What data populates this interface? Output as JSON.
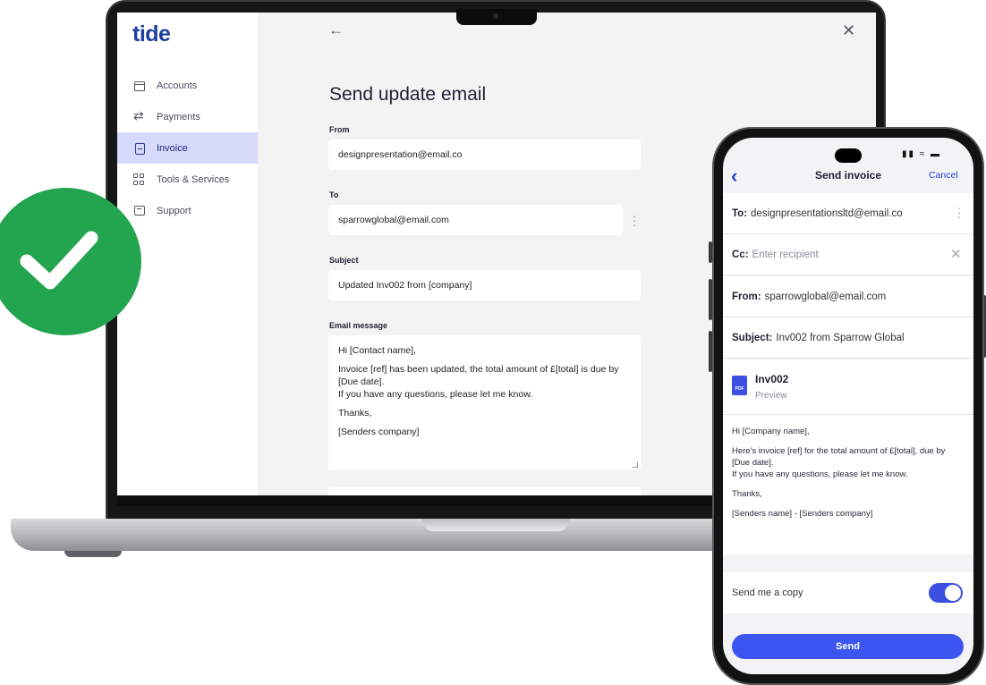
{
  "brand": {
    "logo": "tide"
  },
  "sidebar": {
    "items": [
      {
        "label": "Accounts",
        "icon": "accounts-icon"
      },
      {
        "label": "Payments",
        "icon": "transfer-icon"
      },
      {
        "label": "Invoice",
        "icon": "invoice-icon",
        "active": true
      },
      {
        "label": "Tools & Services",
        "icon": "grid-icon"
      },
      {
        "label": "Support",
        "icon": "chat-icon"
      }
    ]
  },
  "form": {
    "title": "Send update email",
    "from_label": "From",
    "from_value": "designpresentation@email.co",
    "to_label": "To",
    "to_value": "sparrowglobal@email.com",
    "subject_label": "Subject",
    "subject_value": "Updated Inv002 from [company]",
    "message_label": "Email message",
    "message": {
      "greeting": "Hi [Contact name],",
      "line1": "Invoice [ref] has  been updated, the total amount of £[total] is due by [Due date].",
      "line2": "If you have any questions, please let me know.",
      "signoff": "Thanks,",
      "signature": "[Senders company]"
    }
  },
  "phone": {
    "title": "Send invoice",
    "cancel": "Cancel",
    "to_label": "To:",
    "to_value": "designpresentationsltd@email.co",
    "cc_label": "Cc:",
    "cc_placeholder": "Enter recipient",
    "from_label": "From:",
    "from_value": "sparrowglobal@email.com",
    "subject_label": "Subject:",
    "subject_value": "Inv002 from Sparrow Global",
    "attachment": {
      "type": "PDF",
      "name": "Inv002",
      "sub": "Preview"
    },
    "body": {
      "greeting": "Hi [Company name],",
      "line1": "Here's invoice [ref] for the total amount of £[total], due by [Due date].",
      "line2": "If you have any questions, please let me know.",
      "signoff": "Thanks,",
      "signature": "[Senders name] - [Senders company]"
    },
    "copy_label": "Send me a copy",
    "copy_enabled": true,
    "send": "Send"
  },
  "colors": {
    "brand": "#1e3d9e",
    "accent": "#3d55f0",
    "success": "#23a44e",
    "active_nav": "#d5d9fa"
  }
}
